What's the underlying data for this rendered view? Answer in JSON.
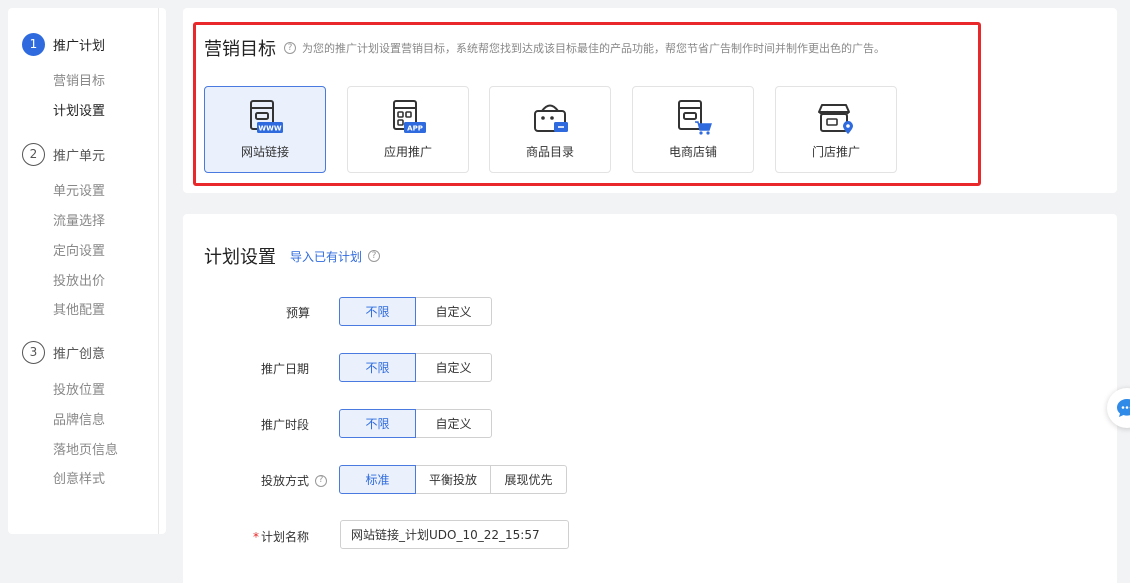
{
  "sidebar": {
    "steps": [
      {
        "num": "1",
        "label": "推广计划",
        "subs": [
          "营销目标",
          "计划设置"
        ]
      },
      {
        "num": "2",
        "label": "推广单元",
        "subs": [
          "单元设置",
          "流量选择",
          "定向设置",
          "投放出价",
          "其他配置"
        ]
      },
      {
        "num": "3",
        "label": "推广创意",
        "subs": [
          "投放位置",
          "品牌信息",
          "落地页信息",
          "创意样式"
        ]
      }
    ]
  },
  "goal": {
    "title": "营销目标",
    "help": "?",
    "description": "为您的推广计划设置营销目标，系统帮您找到达成该目标最佳的产品功能，帮您节省广告制作时间并制作更出色的广告。",
    "options": [
      {
        "label": "网站链接",
        "badge": "WWW",
        "icon": "website-link-icon"
      },
      {
        "label": "应用推广",
        "badge": "APP",
        "icon": "app-promotion-icon"
      },
      {
        "label": "商品目录",
        "icon": "product-catalog-icon"
      },
      {
        "label": "电商店铺",
        "icon": "ecommerce-store-icon"
      },
      {
        "label": "门店推广",
        "icon": "store-promotion-icon"
      }
    ],
    "accent_color": "#2f6bde",
    "highlight_color": "#e8282a"
  },
  "plan": {
    "title": "计划设置",
    "import_link": "导入已有计划",
    "help": "?",
    "fields": {
      "budget": {
        "label": "预算",
        "options": [
          "不限",
          "自定义"
        ]
      },
      "date": {
        "label": "推广日期",
        "options": [
          "不限",
          "自定义"
        ]
      },
      "period": {
        "label": "推广时段",
        "options": [
          "不限",
          "自定义"
        ]
      },
      "mode": {
        "label": "投放方式",
        "options": [
          "标准",
          "平衡投放",
          "展现优先"
        ]
      },
      "name": {
        "required_mark": "*",
        "label": "计划名称",
        "value": "网站链接_计划UDO_10_22_15:57"
      }
    }
  }
}
